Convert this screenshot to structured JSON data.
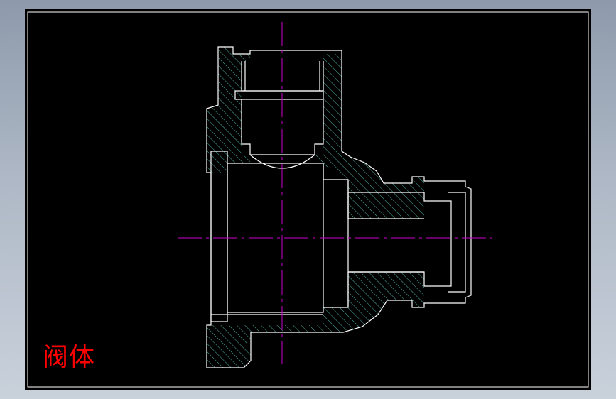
{
  "drawing": {
    "title": "阀体"
  },
  "colors": {
    "background": "#000000",
    "frame": "#ffffff",
    "outline": "#ffffff",
    "hatch": "#4fb3a9",
    "centerline": "#cc00cc",
    "title": "#ff0000"
  },
  "icons": {
    "hatching": "section-hatch-pattern"
  }
}
